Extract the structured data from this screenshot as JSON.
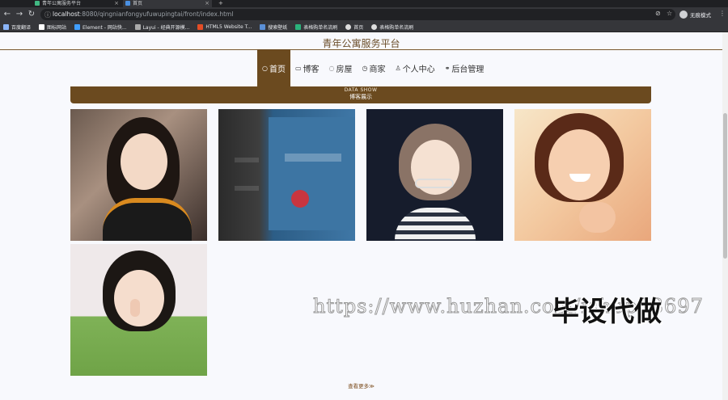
{
  "browser": {
    "tabs": [
      {
        "label": "青年公寓服务平台",
        "active": false
      },
      {
        "label": "首页",
        "active": true
      }
    ],
    "url_host": "localhost",
    "url_rest": ":8080/qingnianfongyufuwupingtai/front/index.html",
    "profile_label": "无痕模式",
    "bookmarks": [
      "百度翻译",
      "图标网站",
      "Element - 网站快...",
      "Layui - 经典开源模...",
      "HTML5 Website T...",
      "搜索壁纸",
      "表格购单名流刷",
      "首页",
      "表格购单名流刷"
    ]
  },
  "site": {
    "title": "青年公寓服务平台",
    "nav": [
      {
        "label": "首页",
        "icon": "home-icon",
        "active": true
      },
      {
        "label": "博客",
        "icon": "blog-icon",
        "active": false
      },
      {
        "label": "房屋",
        "icon": "house-icon",
        "active": false
      },
      {
        "label": "商家",
        "icon": "shop-icon",
        "active": false
      },
      {
        "label": "个人中心",
        "icon": "user-icon",
        "active": false
      },
      {
        "label": "后台管理",
        "icon": "link-icon",
        "active": false
      }
    ],
    "section": {
      "title_en": "DATA SHOW",
      "title_zh": "博客展示"
    },
    "more_label": "查看更多≫"
  },
  "watermark": {
    "url": "https://www.huzhan.com/ishop33697",
    "tag": "毕设代做"
  },
  "colors": {
    "brand": "#6b4a1f",
    "page_bg": "#f8f9fd"
  }
}
